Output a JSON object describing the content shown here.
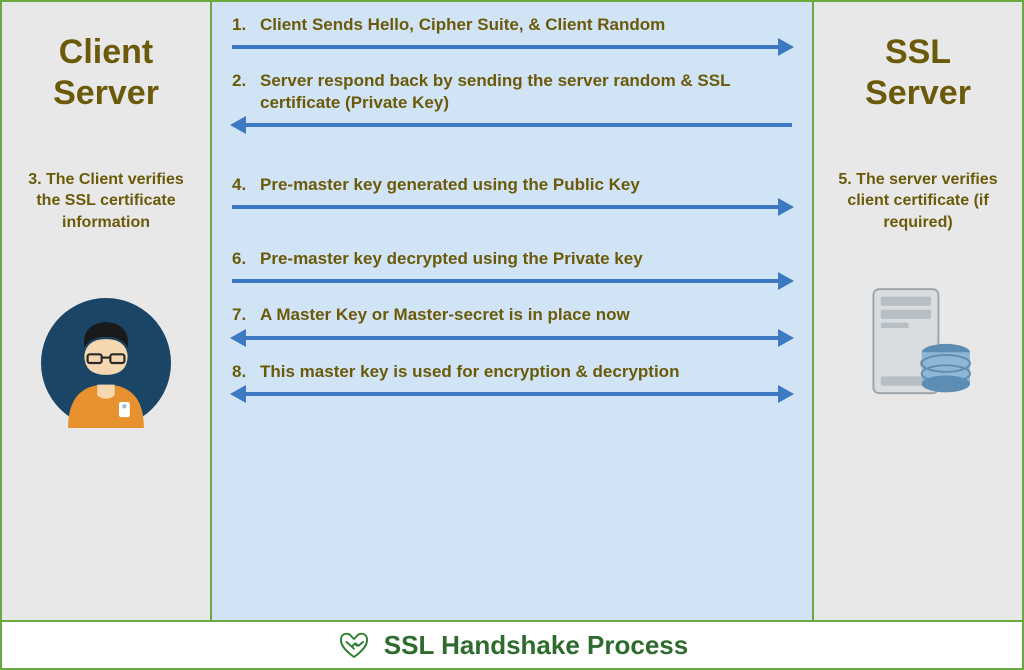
{
  "left": {
    "title_line1": "Client",
    "title_line2": "Server",
    "note": "3. The Client verifies the SSL certificate information"
  },
  "right": {
    "title_line1": "SSL",
    "title_line2": "Server",
    "note": "5. The server verifies client certificate (if required)"
  },
  "steps": [
    {
      "num": "1.",
      "label": "Client Sends Hello, Cipher Suite, & Client Random",
      "dir": "right"
    },
    {
      "num": "2.",
      "label": "Server respond back by sending the server random & SSL certificate (Private Key)",
      "dir": "left"
    },
    {
      "num": "4.",
      "label": "Pre-master key generated using the Public Key",
      "dir": "right"
    },
    {
      "num": "6.",
      "label": "Pre-master key decrypted using the Private key",
      "dir": "right"
    },
    {
      "num": "7.",
      "label": "A Master Key or Master-secret is in place now",
      "dir": "both"
    },
    {
      "num": "8.",
      "label": "This master key is used for encryption & decryption",
      "dir": "both"
    }
  ],
  "footer": {
    "title": "SSL Handshake Process"
  },
  "colors": {
    "accent": "#6b5a0a",
    "arrow": "#3d78c2",
    "border": "#6ba840"
  }
}
